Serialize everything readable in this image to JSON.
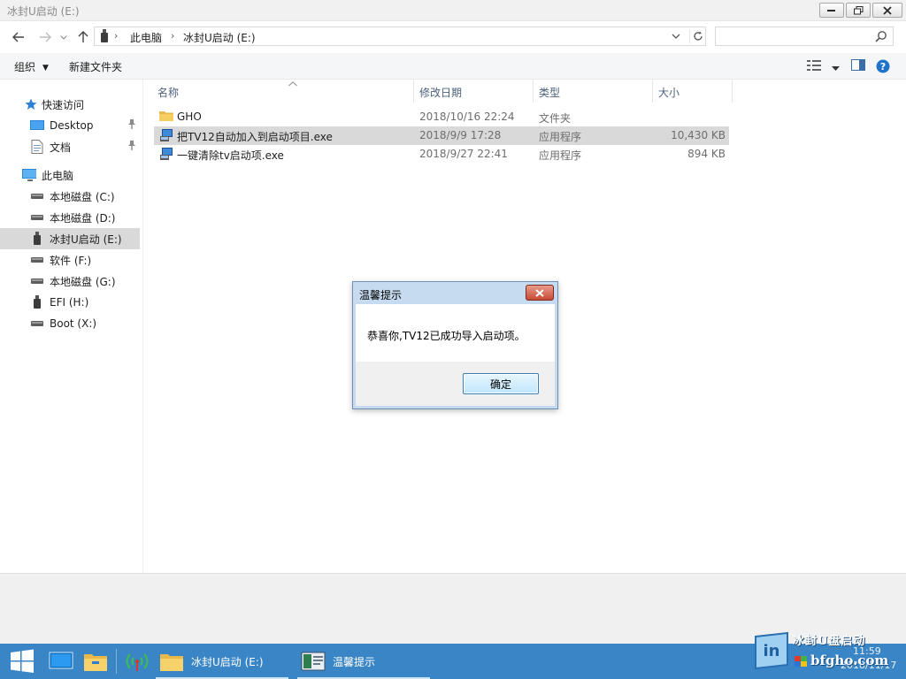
{
  "window": {
    "title": "冰封U启动 (E:)",
    "controls": {
      "minimize": "minimize",
      "maximize": "restore",
      "close": "close"
    }
  },
  "address": {
    "crumbs": [
      "此电脑",
      "冰封U启动 (E:)"
    ],
    "search_placeholder": ""
  },
  "toolbar": {
    "organize_label": "组织",
    "new_folder_label": "新建文件夹"
  },
  "sidebar": {
    "quick_access": {
      "label": "快速访问",
      "items": [
        {
          "label": "Desktop",
          "icon": "desktop-icon",
          "pinned": true
        },
        {
          "label": "文档",
          "icon": "document-icon",
          "pinned": true
        }
      ]
    },
    "this_pc": {
      "label": "此电脑",
      "items": [
        {
          "label": "本地磁盘 (C:)",
          "icon": "drive-icon"
        },
        {
          "label": "本地磁盘 (D:)",
          "icon": "drive-icon"
        },
        {
          "label": "冰封U启动 (E:)",
          "icon": "usb-drive-icon",
          "selected": true
        },
        {
          "label": "软件 (F:)",
          "icon": "drive-icon"
        },
        {
          "label": "本地磁盘 (G:)",
          "icon": "drive-icon"
        },
        {
          "label": "EFI (H:)",
          "icon": "usb-drive-icon"
        },
        {
          "label": "Boot (X:)",
          "icon": "drive-icon"
        }
      ]
    }
  },
  "files": {
    "columns": {
      "name": "名称",
      "modified": "修改日期",
      "type": "类型",
      "size": "大小"
    },
    "rows": [
      {
        "name": "GHO",
        "modified": "2018/10/16 22:24",
        "type": "文件夹",
        "size": "",
        "icon": "folder-icon"
      },
      {
        "name": "把TV12自动加入到启动项目.exe",
        "modified": "2018/9/9 17:28",
        "type": "应用程序",
        "size": "10,430 KB",
        "icon": "exe-icon",
        "highlighted": true
      },
      {
        "name": "一键清除tv启动项.exe",
        "modified": "2018/9/27 22:41",
        "type": "应用程序",
        "size": "894 KB",
        "icon": "exe-icon"
      }
    ]
  },
  "dialog": {
    "title": "温馨提示",
    "message": "恭喜你,TV12已成功导入启动项。",
    "ok_label": "确定"
  },
  "taskbar": {
    "items": [
      {
        "label": "冰封U启动 (E:)",
        "icon": "folder-icon"
      },
      {
        "label": "温馨提示",
        "icon": "app-window-icon"
      }
    ],
    "tray": {
      "watermark": "冰封U盘启动",
      "site": "bfgho.com",
      "time": "11:59",
      "date": "2018/11/17"
    }
  },
  "colors": {
    "taskbar": "#3a85c6",
    "selection": "#d9d9d9",
    "header_text": "#4c607a",
    "dialog_frame": "#c6dbf0"
  }
}
